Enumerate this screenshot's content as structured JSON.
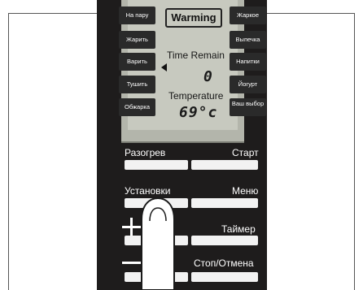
{
  "display": {
    "mode_label": "Warming",
    "time_label": "Time Remain",
    "time_value": "0",
    "temp_label": "Temperature",
    "temp_value": "69°c"
  },
  "left_buttons": [
    "На пару",
    "Жарить",
    "Варить",
    "Тушить",
    "Обжарка"
  ],
  "right_buttons": [
    "Жаркое",
    "Выпечка",
    "Напитки",
    "Йогурт",
    "Ваш выбор"
  ],
  "controls": {
    "reheat": "Разогрев",
    "start": "Старт",
    "settings": "Установки",
    "menu": "Меню",
    "timer": "Таймер",
    "stop_cancel": "Стоп/Отмена"
  },
  "colors": {
    "panel": "#1e1c1c",
    "lcd": "#c7c9bf",
    "button_bar": "#f2f2f2"
  }
}
